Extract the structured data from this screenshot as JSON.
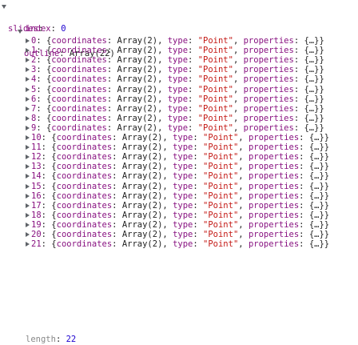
{
  "tree": {
    "root_key": "slides",
    "index_key": "index",
    "index_value": "0",
    "outline_key": "outline",
    "outline_summary": "Array(22)",
    "items": [
      {
        "index": "0",
        "key1": "coordinates",
        "val1": "Array(2)",
        "key2": "type",
        "val2": "\"Point\"",
        "key3": "properties",
        "val3": "{…}"
      },
      {
        "index": "1",
        "key1": "coordinates",
        "val1": "Array(2)",
        "key2": "type",
        "val2": "\"Point\"",
        "key3": "properties",
        "val3": "{…}"
      },
      {
        "index": "2",
        "key1": "coordinates",
        "val1": "Array(2)",
        "key2": "type",
        "val2": "\"Point\"",
        "key3": "properties",
        "val3": "{…}"
      },
      {
        "index": "3",
        "key1": "coordinates",
        "val1": "Array(2)",
        "key2": "type",
        "val2": "\"Point\"",
        "key3": "properties",
        "val3": "{…}"
      },
      {
        "index": "4",
        "key1": "coordinates",
        "val1": "Array(2)",
        "key2": "type",
        "val2": "\"Point\"",
        "key3": "properties",
        "val3": "{…}"
      },
      {
        "index": "5",
        "key1": "coordinates",
        "val1": "Array(2)",
        "key2": "type",
        "val2": "\"Point\"",
        "key3": "properties",
        "val3": "{…}"
      },
      {
        "index": "6",
        "key1": "coordinates",
        "val1": "Array(2)",
        "key2": "type",
        "val2": "\"Point\"",
        "key3": "properties",
        "val3": "{…}"
      },
      {
        "index": "7",
        "key1": "coordinates",
        "val1": "Array(2)",
        "key2": "type",
        "val2": "\"Point\"",
        "key3": "properties",
        "val3": "{…}"
      },
      {
        "index": "8",
        "key1": "coordinates",
        "val1": "Array(2)",
        "key2": "type",
        "val2": "\"Point\"",
        "key3": "properties",
        "val3": "{…}"
      },
      {
        "index": "9",
        "key1": "coordinates",
        "val1": "Array(2)",
        "key2": "type",
        "val2": "\"Point\"",
        "key3": "properties",
        "val3": "{…}"
      },
      {
        "index": "10",
        "key1": "coordinates",
        "val1": "Array(2)",
        "key2": "type",
        "val2": "\"Point\"",
        "key3": "properties",
        "val3": "{…}"
      },
      {
        "index": "11",
        "key1": "coordinates",
        "val1": "Array(2)",
        "key2": "type",
        "val2": "\"Point\"",
        "key3": "properties",
        "val3": "{…}"
      },
      {
        "index": "12",
        "key1": "coordinates",
        "val1": "Array(2)",
        "key2": "type",
        "val2": "\"Point\"",
        "key3": "properties",
        "val3": "{…}"
      },
      {
        "index": "13",
        "key1": "coordinates",
        "val1": "Array(2)",
        "key2": "type",
        "val2": "\"Point\"",
        "key3": "properties",
        "val3": "{…}"
      },
      {
        "index": "14",
        "key1": "coordinates",
        "val1": "Array(2)",
        "key2": "type",
        "val2": "\"Point\"",
        "key3": "properties",
        "val3": "{…}"
      },
      {
        "index": "15",
        "key1": "coordinates",
        "val1": "Array(2)",
        "key2": "type",
        "val2": "\"Point\"",
        "key3": "properties",
        "val3": "{…}"
      },
      {
        "index": "16",
        "key1": "coordinates",
        "val1": "Array(2)",
        "key2": "type",
        "val2": "\"Point\"",
        "key3": "properties",
        "val3": "{…}"
      },
      {
        "index": "17",
        "key1": "coordinates",
        "val1": "Array(2)",
        "key2": "type",
        "val2": "\"Point\"",
        "key3": "properties",
        "val3": "{…}"
      },
      {
        "index": "18",
        "key1": "coordinates",
        "val1": "Array(2)",
        "key2": "type",
        "val2": "\"Point\"",
        "key3": "properties",
        "val3": "{…}"
      },
      {
        "index": "19",
        "key1": "coordinates",
        "val1": "Array(2)",
        "key2": "type",
        "val2": "\"Point\"",
        "key3": "properties",
        "val3": "{…}"
      },
      {
        "index": "20",
        "key1": "coordinates",
        "val1": "Array(2)",
        "key2": "type",
        "val2": "\"Point\"",
        "key3": "properties",
        "val3": "{…}"
      },
      {
        "index": "21",
        "key1": "coordinates",
        "val1": "Array(2)",
        "key2": "type",
        "val2": "\"Point\"",
        "key3": "properties",
        "val3": "{…}"
      }
    ],
    "length_key": "length",
    "length_value": "22"
  },
  "colors": {
    "key": "#881280",
    "number": "#1c00cf",
    "string": "#c41a16",
    "text": "#222222",
    "arrow": "#5f6368"
  }
}
